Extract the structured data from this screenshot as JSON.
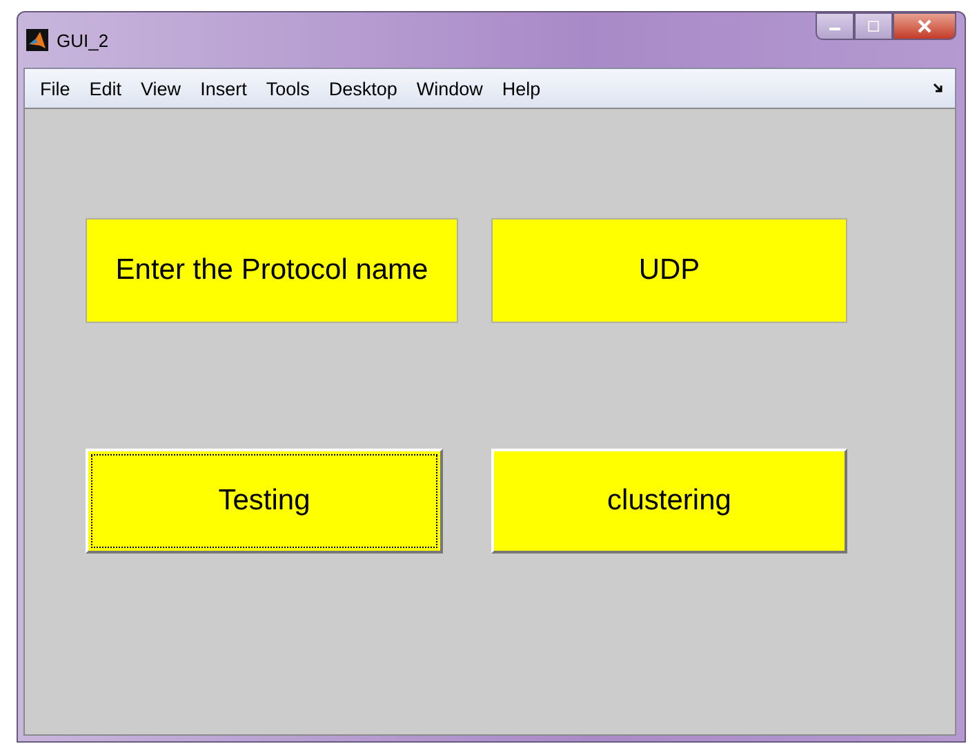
{
  "window": {
    "title": "GUI_2"
  },
  "menu": [
    "File",
    "Edit",
    "View",
    "Insert",
    "Tools",
    "Desktop",
    "Window",
    "Help"
  ],
  "rows": [
    [
      {
        "kind": "label",
        "text": "Enter the Protocol name"
      },
      {
        "kind": "field",
        "value": "UDP"
      }
    ],
    [
      {
        "kind": "button",
        "text": "Testing",
        "focused": true
      },
      {
        "kind": "button",
        "text": "clustering",
        "focused": false
      }
    ]
  ]
}
